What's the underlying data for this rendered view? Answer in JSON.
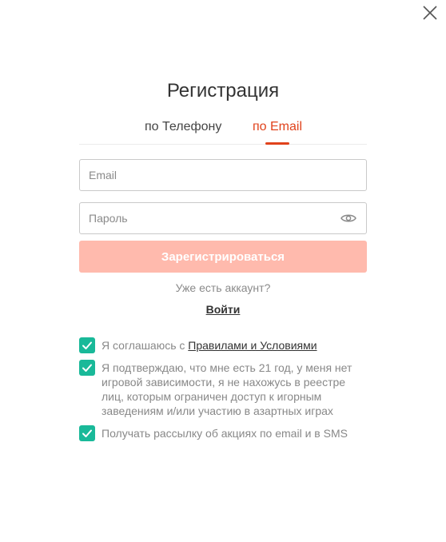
{
  "modal": {
    "title": "Регистрация",
    "close_icon": "close-icon"
  },
  "tabs": [
    {
      "label": "по Телефону",
      "active": false
    },
    {
      "label": "по Email",
      "active": true
    }
  ],
  "form": {
    "email_placeholder": "Email",
    "email_value": "",
    "password_placeholder": "Пароль",
    "password_value": "",
    "password_toggle_icon": "eye-icon",
    "submit_label": "Зарегистрироваться"
  },
  "login": {
    "prompt": "Уже есть аккаунт?",
    "link_label": "Войти"
  },
  "agreements": {
    "terms_prefix": "Я соглашаюсь с ",
    "terms_link": "Правилами и Условиями",
    "age_confirm": "Я подтверждаю, что мне есть 21 год, у меня нет игровой зависимости, я не нахожусь в реестре лиц, которым ограничен доступ к игорным заведениям и/или участию в азартных играх",
    "newsletter": "Получать рассылку об акциях по email и в SMS",
    "checked": [
      true,
      true,
      true
    ]
  },
  "colors": {
    "accent": "#e0421b",
    "button_disabled": "#ffbaad",
    "checkbox": "#19b999"
  }
}
